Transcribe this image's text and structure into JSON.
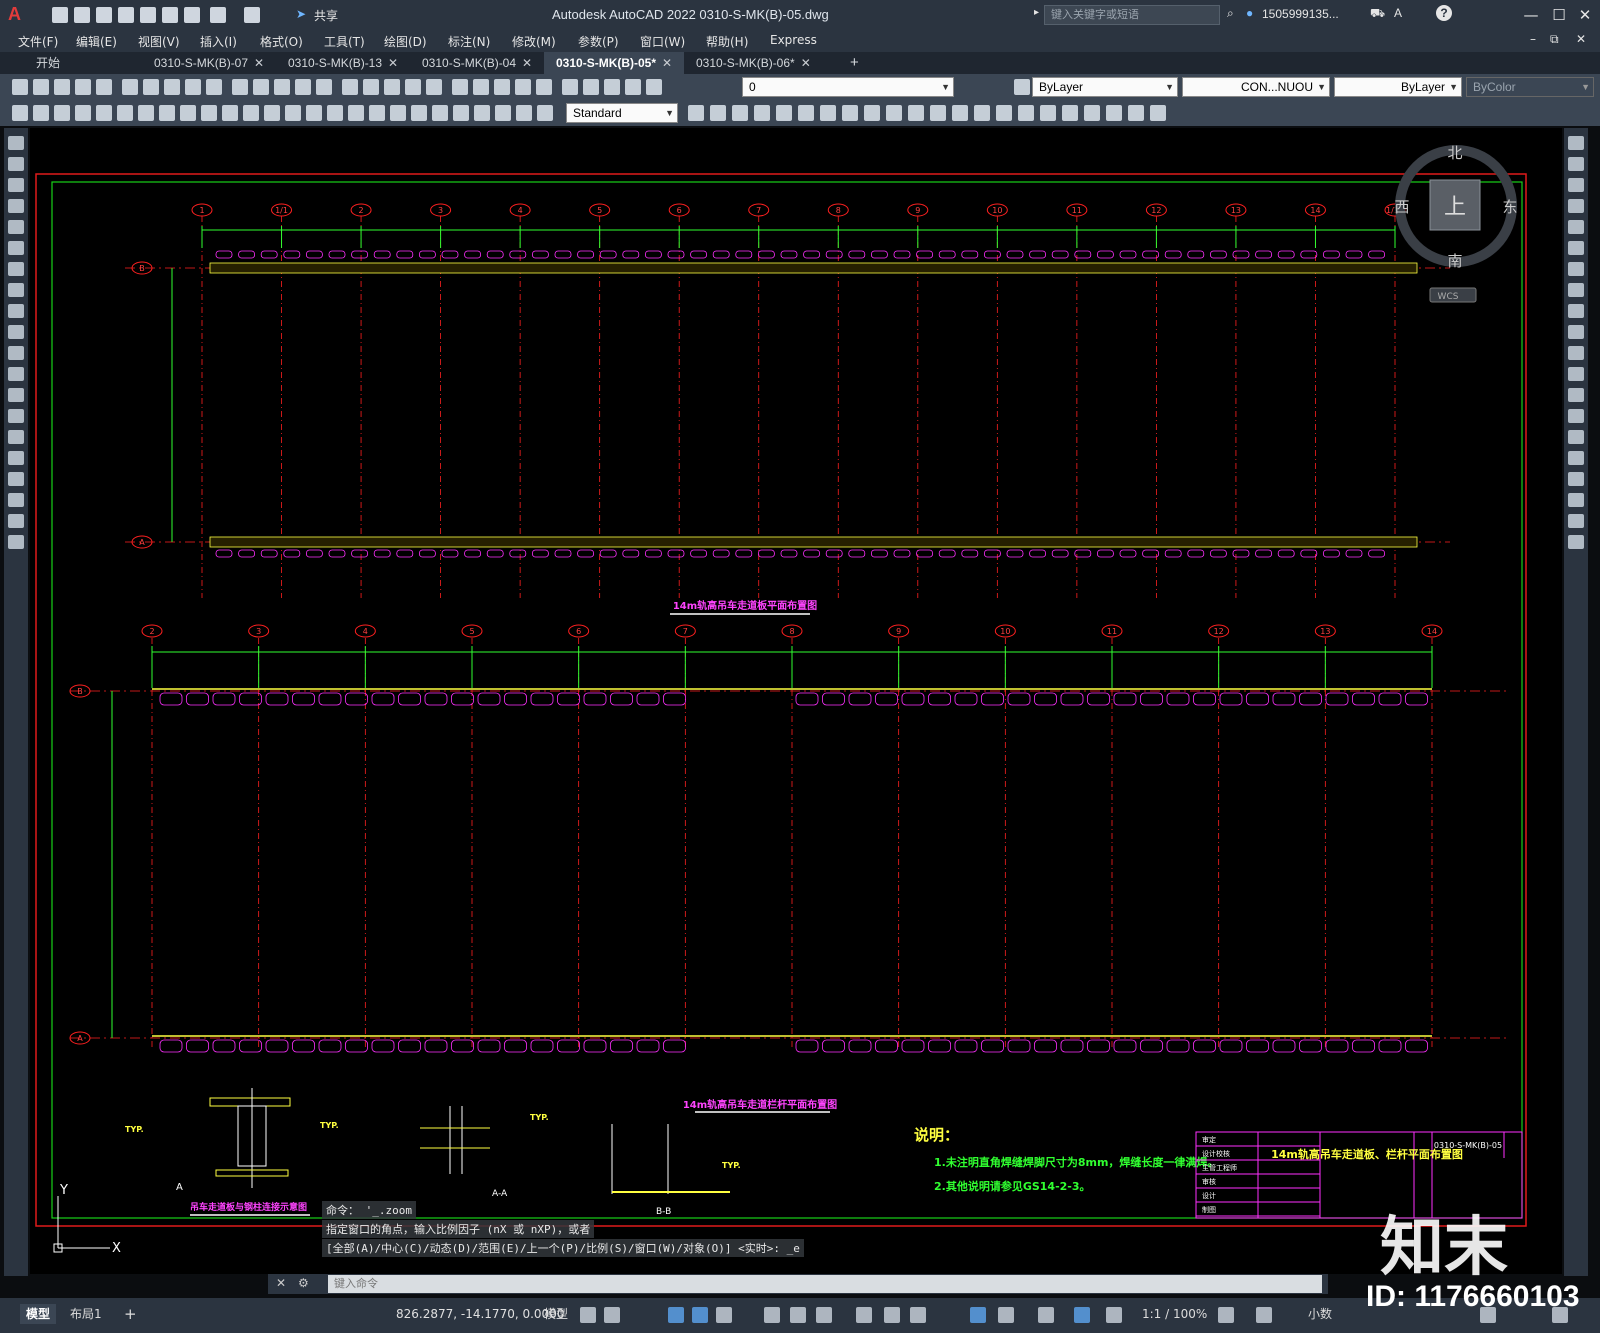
{
  "window": {
    "title": "Autodesk AutoCAD 2022    0310-S-MK(B)-05.dwg",
    "share_label": "共享",
    "search_placeholder": "键入关键字或短语",
    "user": "1505999135...",
    "minimize": "—",
    "maximize": "☐",
    "close": "✕"
  },
  "menu": [
    {
      "label": "文件(F)"
    },
    {
      "label": "编辑(E)"
    },
    {
      "label": "视图(V)"
    },
    {
      "label": "插入(I)"
    },
    {
      "label": "格式(O)"
    },
    {
      "label": "工具(T)"
    },
    {
      "label": "绘图(D)"
    },
    {
      "label": "标注(N)"
    },
    {
      "label": "修改(M)"
    },
    {
      "label": "参数(P)"
    },
    {
      "label": "窗口(W)"
    },
    {
      "label": "帮助(H)"
    },
    {
      "label": "Express"
    }
  ],
  "tabs": [
    {
      "label": "开始",
      "active": false
    },
    {
      "label": "0310-S-MK(B)-07",
      "active": false
    },
    {
      "label": "0310-S-MK(B)-13",
      "active": false
    },
    {
      "label": "0310-S-MK(B)-04",
      "active": false
    },
    {
      "label": "0310-S-MK(B)-05*",
      "active": true
    },
    {
      "label": "0310-S-MK(B)-06*",
      "active": false
    }
  ],
  "toolbar": {
    "layer_value": "0",
    "color_value": "ByLayer",
    "linetype_value": "CON...NUOU",
    "lineweight_value": "ByLayer",
    "plotstyle_value": "ByColor",
    "textstyle_value": "Standard"
  },
  "viewcube": {
    "north": "北",
    "south": "南",
    "east": "东",
    "west": "西",
    "face": "上",
    "wcs": "WCS"
  },
  "drawing": {
    "plan1_title": "14m轨高吊车走道板平面布置图",
    "plan2_title": "14m轨高吊车走道栏杆平面布置图",
    "detail1_title": "吊车走道板与钢柱连接示意图",
    "detail1_label": "A",
    "detail2_label": "A-A",
    "detail3_label": "B-B",
    "typ": "TYP.",
    "axis_top": [
      "1",
      "1/1",
      "2",
      "3",
      "4",
      "5",
      "6",
      "7",
      "8",
      "9",
      "10",
      "11",
      "12",
      "13",
      "14",
      "1/14"
    ],
    "axis_mid": [
      "2",
      "3",
      "4",
      "5",
      "6",
      "7",
      "8",
      "9",
      "10",
      "11",
      "12",
      "13",
      "14"
    ],
    "row_b": "B",
    "row_a": "A",
    "notes_title": "说明：",
    "note1": "1.未注明直角焊缝焊脚尺寸为8mm，焊缝长度一律满焊。",
    "note2": "2.其他说明请参见GS14-2-3。",
    "title_block_name": "14m轨高吊车走道板、栏杆平面布置图",
    "title_block_number": "0310-S-MK(B)-05",
    "tb_rows": [
      "审定",
      "设计校核",
      "主管工程师",
      "审核",
      "设计",
      "制图"
    ]
  },
  "command": {
    "line1": "命令： '_.zoom",
    "line2": "指定窗口的角点，输入比例因子 (nX 或 nXP)，或者",
    "line3": "[全部(A)/中心(C)/动态(D)/范围(E)/上一个(P)/比例(S)/窗口(W)/对象(O)] <实时>: _e",
    "placeholder": "键入命令"
  },
  "status": {
    "model_tab": "模型",
    "layout_tab": "布局1",
    "coords": "826.2877, -14.1770, 0.0000",
    "model_label": "模型",
    "scale": "1:1 / 100%",
    "units": "小数"
  },
  "watermark": {
    "brand": "知末",
    "id": "ID: 1176660103"
  }
}
